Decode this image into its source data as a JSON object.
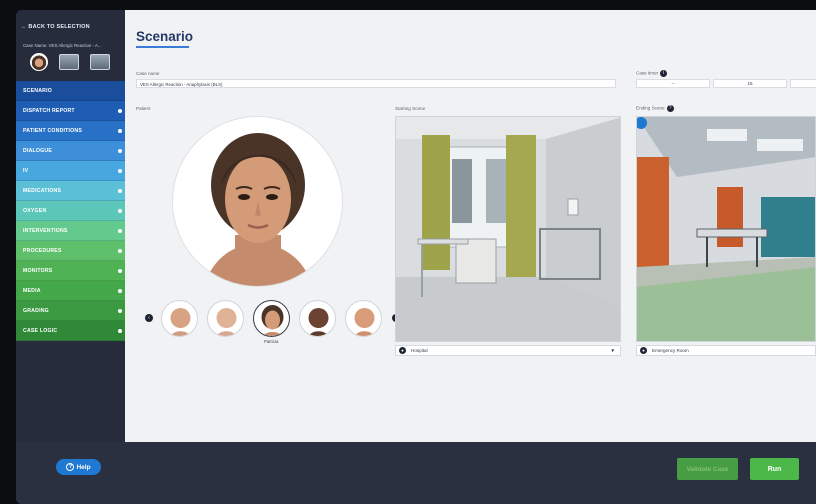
{
  "sidebar": {
    "back_label": "← BACK TO SELECTION",
    "case_name": "Case Name: VES Allergic Reaction - A...",
    "items": [
      {
        "label": "SCENARIO",
        "color": "#1a4e9c",
        "has_dot": false
      },
      {
        "label": "DISPATCH REPORT",
        "color": "#1e5db3",
        "has_dot": true
      },
      {
        "label": "PATIENT CONDITIONS",
        "color": "#2771c6",
        "has_dot": true
      },
      {
        "label": "DIALOGUE",
        "color": "#3c8fd8",
        "has_dot": true
      },
      {
        "label": "IV",
        "color": "#47a8e0",
        "has_dot": true
      },
      {
        "label": "MEDICATIONS",
        "color": "#5bbfd7",
        "has_dot": true
      },
      {
        "label": "OXYGEN",
        "color": "#5cc7b9",
        "has_dot": true
      },
      {
        "label": "INTERVENTIONS",
        "color": "#64c98c",
        "has_dot": true
      },
      {
        "label": "PROCEDURES",
        "color": "#5fc06c",
        "has_dot": true
      },
      {
        "label": "MONITORS",
        "color": "#4fb356",
        "has_dot": true
      },
      {
        "label": "MEDIA",
        "color": "#44a74a",
        "has_dot": true
      },
      {
        "label": "GRADING",
        "color": "#3b9a41",
        "has_dot": true
      },
      {
        "label": "CASE LOGIC",
        "color": "#2f8936",
        "has_dot": true
      }
    ]
  },
  "main": {
    "title": "Scenario",
    "case_name_label": "Case name",
    "case_name_value": "VES Allergic Reaction - Anaphylaxis (BLS)",
    "case_timer_label": "Case timer",
    "timer_values": [
      "--",
      "15",
      ""
    ],
    "patient_label": "Patient",
    "starting_scene_label": "Starting Scene",
    "ending_scene_label": "Ending Scene",
    "selected_patient_name": "Patricia",
    "starting_scene_value": "Hospital",
    "ending_scene_value": "Emergency Room"
  },
  "footer": {
    "help_label": "Help",
    "validate_label": "Validate Case",
    "run_label": "Run"
  }
}
